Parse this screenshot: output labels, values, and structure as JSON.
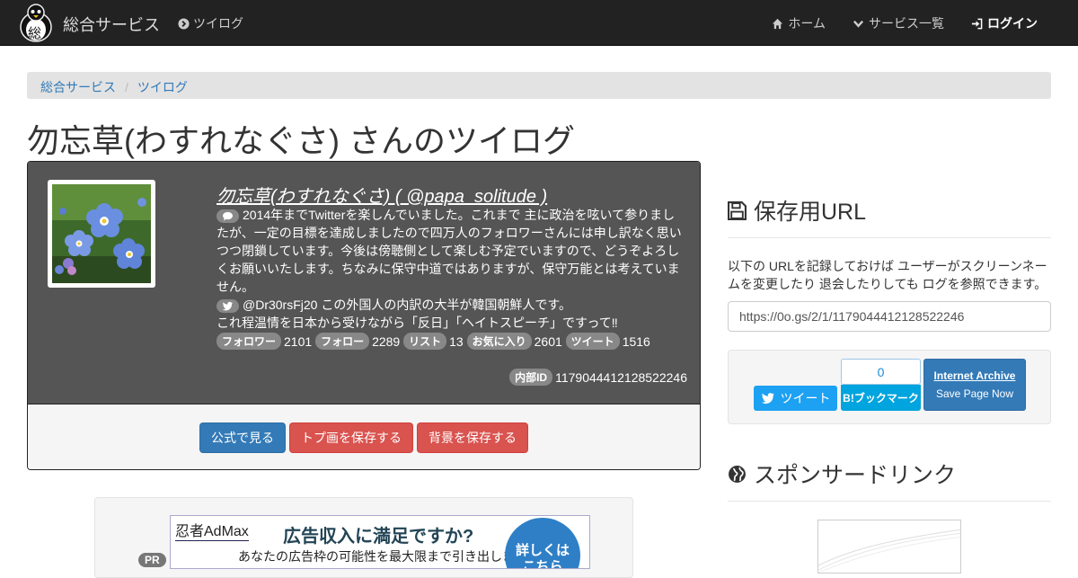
{
  "navbar": {
    "brand": "総合サービス",
    "logo_char": "総",
    "twilog_link": "ツイログ",
    "home": "ホーム",
    "services": "サービス一覧",
    "login": "ログイン"
  },
  "breadcrumb": {
    "items": [
      "総合サービス",
      "ツイログ"
    ],
    "separator": "/"
  },
  "page_title": "勿忘草(わすれなぐさ) さんのツイログ",
  "profile": {
    "name": "勿忘草(わすれなぐさ) ( @papa_solitude )",
    "bio": "2014年までTwitterを楽しんでいました。これまで 主に政治を呟いて参りましたが、一定の目標を達成しましたので四万人のフォロワーさんには申し訳なく思いつつ閉鎖しています。今後は傍聴側として楽しむ予定でいますので、どうぞよろしくお願いいたします。ちなみに保守中道ではありますが、保守万能とは考えていません。",
    "last_tweet": "@Dr30rsFj20 この外国人の内訳の大半が韓国朝鮮人です。",
    "last_tweet_2": "これ程温情を日本から受けながら「反日」「ヘイトスピーチ」ですって‼",
    "stats": [
      {
        "label": "フォロワー",
        "value": "2101"
      },
      {
        "label": "フォロー",
        "value": "2289"
      },
      {
        "label": "リスト",
        "value": "13"
      },
      {
        "label": "お気に入り",
        "value": "2601"
      },
      {
        "label": "ツイート",
        "value": "1516"
      }
    ],
    "internal_id_label": "内部ID",
    "internal_id": "1179044412128522246"
  },
  "actions": {
    "view_official": "公式で見る",
    "save_avatar": "トプ画を保存する",
    "save_background": "背景を保存する"
  },
  "ad": {
    "pr": "PR",
    "brand": "忍者AdMax",
    "headline": "広告収入に満足ですか?",
    "sub": "あなたの広告枠の可能性を最大限まで引き出します",
    "cta_line1": "詳しくは",
    "cta_line2": "こちら"
  },
  "save_url": {
    "title": "保存用URL",
    "description": "以下の URLを記録しておけば ユーザーがスクリーンネームを変更したり 退会したりしても ログを参照できます。",
    "url": "https://0o.gs/2/1/1179044412128522246"
  },
  "share": {
    "tweet": "ツイート",
    "hatena_count": "0",
    "hatena_label": "B!ブックマーク",
    "ia_title": "Internet Archive",
    "ia_sub": "Save Page Now"
  },
  "sponsored": {
    "title": "スポンサードリンク"
  },
  "colors": {
    "navbar": "#222222",
    "panel": "#555555",
    "primary": "#337ab7",
    "danger": "#d9534f",
    "twitter": "#1da1f2",
    "hatena": "#00a4de"
  }
}
